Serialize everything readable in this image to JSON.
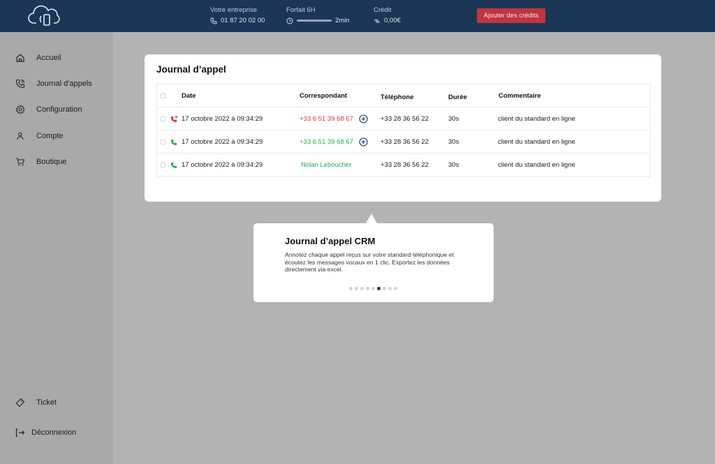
{
  "topbar": {
    "company_label": "Votre entreprise",
    "company_phone": "01 87 20 02 00",
    "plan_label": "Forfait 6H",
    "plan_usage": "2min",
    "credit_label": "Crédit",
    "credit_value": "0,00€",
    "add_credits_button": "Ajouter des crédits"
  },
  "sidebar": {
    "items": [
      {
        "label": "Accueil",
        "icon": "home-icon"
      },
      {
        "label": "Journal d'appels",
        "icon": "phone-log-icon"
      },
      {
        "label": "Configuration",
        "icon": "gear-icon"
      },
      {
        "label": "Compte",
        "icon": "user-icon"
      },
      {
        "label": "Boutique",
        "icon": "cart-icon"
      }
    ],
    "bottom": [
      {
        "label": "Ticket",
        "icon": "ticket-icon"
      },
      {
        "label": "Déconnexion",
        "icon": "logout-icon"
      }
    ]
  },
  "call_log": {
    "title": "Journal d’appel",
    "columns": [
      "Date",
      "Correspondant",
      "Téléphone",
      "Durée",
      "Commentaire"
    ],
    "rows": [
      {
        "status": "missed",
        "date": "17 octobre 2022 à 09:34:29",
        "correspondent": "+33 6 51 39 68 67",
        "correspondent_color": "#d2383f",
        "has_add": true,
        "phone": "+33 28 36 56 22",
        "duration": "30s",
        "comment": "client du standard en ligne"
      },
      {
        "status": "answered",
        "date": "17 octobre 2022 à 09:34:29",
        "correspondent": "+33 6 51 39 68 67",
        "correspondent_color": "#2da84a",
        "has_add": true,
        "phone": "+33 28 36 56 22",
        "duration": "30s",
        "comment": "client du standard en ligne"
      },
      {
        "status": "answered",
        "date": "17 octobre 2022 à 09:34:29",
        "correspondent": "Nolan Leboucher",
        "correspondent_color": "#2da84a",
        "has_add": false,
        "phone": "+33 28 36 56 22",
        "duration": "30s",
        "comment": "client du standard en ligne"
      }
    ]
  },
  "tooltip": {
    "title": "Journal d’appel CRM",
    "text": "Annotez chaque appel reçus sur votre standard téléphonique et écoutez les messages vocaux en 1 clic. Exportez les données directement via excel.",
    "dots_total": 9,
    "dots_active": 6
  },
  "colors": {
    "topbar": "#1c3657",
    "accent_red": "#c0353f",
    "missed": "#d2383f",
    "answered": "#2da84a"
  }
}
